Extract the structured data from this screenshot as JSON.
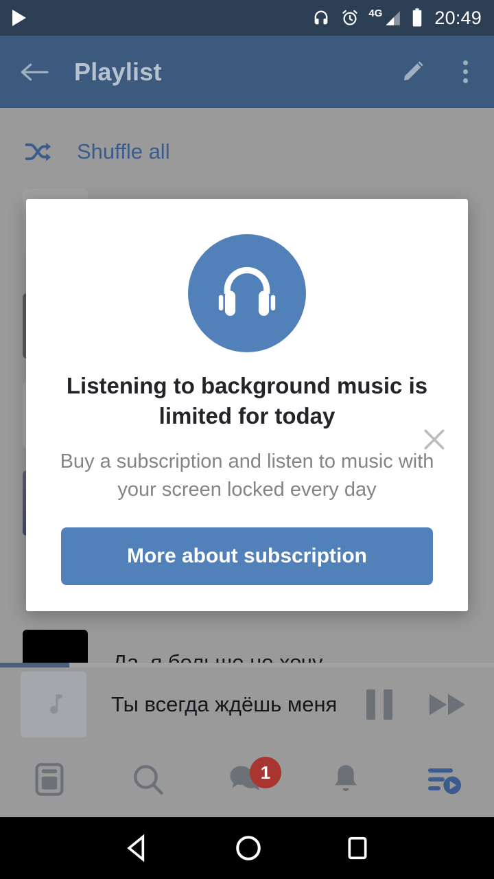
{
  "statusbar": {
    "time": "20:49",
    "icons": [
      "play-icon",
      "headphones-icon",
      "alarm-icon",
      "signal-4g-icon",
      "battery-icon"
    ],
    "network_label": "4G"
  },
  "appbar": {
    "back_icon": "back-arrow-icon",
    "title": "Playlist",
    "edit_icon": "pencil-icon",
    "overflow_icon": "more-vertical-icon"
  },
  "playlist": {
    "shuffle": {
      "icon": "shuffle-icon",
      "label": "Shuffle all"
    },
    "tracks": [
      {
        "title": "",
        "art_color": "#9fa0a2"
      },
      {
        "title": "",
        "art_color": "#585a5e"
      },
      {
        "title": "",
        "art_color": "#a3a4a6"
      },
      {
        "title": "",
        "art_color": "#4a4a73"
      },
      {
        "title": "Да, я больше не хочу",
        "art_color": "#000000"
      }
    ]
  },
  "miniplayer": {
    "art_icon": "music-note-icon",
    "title": "Ты всегда ждёшь меня",
    "pause_icon": "pause-icon",
    "next_icon": "fast-forward-icon",
    "progress_percent": 14
  },
  "bottomnav": {
    "items": [
      {
        "name": "feed",
        "icon": "feed-icon",
        "active": false,
        "badge": ""
      },
      {
        "name": "search",
        "icon": "search-icon",
        "active": false,
        "badge": ""
      },
      {
        "name": "messages",
        "icon": "messages-icon",
        "active": false,
        "badge": "1"
      },
      {
        "name": "notifications",
        "icon": "bell-icon",
        "active": false,
        "badge": ""
      },
      {
        "name": "music",
        "icon": "music-playlist-icon",
        "active": true,
        "badge": ""
      }
    ],
    "badge_color": "#a8352f",
    "active_color": "#3a5b8b",
    "inactive_color": "#6c7077"
  },
  "dialog": {
    "close_icon": "close-icon",
    "hero_icon": "headphones-icon",
    "title": "Listening to background music is limited for today",
    "body": "Buy a subscription and listen to music with your screen locked every day",
    "button_label": "More about subscription",
    "accent_color": "#5181b8"
  },
  "androidnav": {
    "back_icon": "nav-back-icon",
    "home_icon": "nav-home-icon",
    "recents_icon": "nav-recents-icon"
  }
}
